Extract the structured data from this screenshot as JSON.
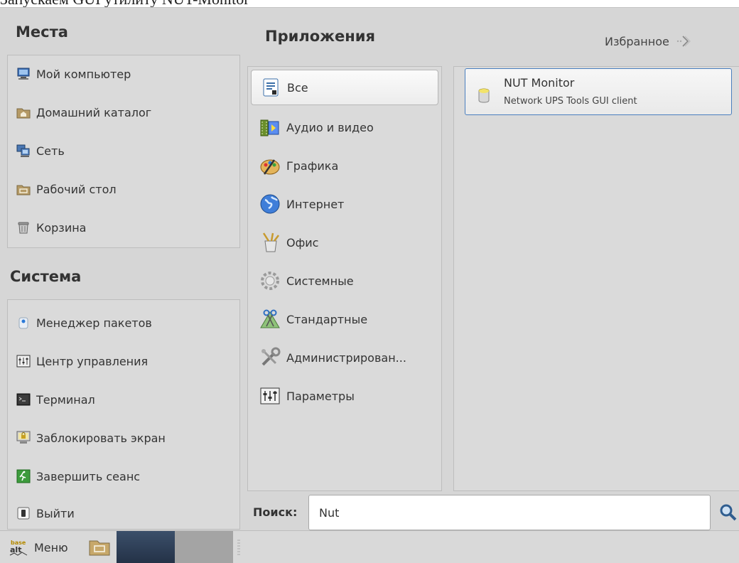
{
  "caption": "Запускаем GUI утилиту NUT-Monitor",
  "places": {
    "title": "Места",
    "items": [
      {
        "label": "Мой компьютер",
        "icon": "computer-icon"
      },
      {
        "label": "Домашний каталог",
        "icon": "home-folder-icon"
      },
      {
        "label": "Сеть",
        "icon": "network-icon"
      },
      {
        "label": "Рабочий стол",
        "icon": "desktop-folder-icon"
      },
      {
        "label": "Корзина",
        "icon": "trash-icon"
      }
    ]
  },
  "system": {
    "title": "Система",
    "items": [
      {
        "label": "Менеджер пакетов",
        "icon": "package-manager-icon"
      },
      {
        "label": "Центр управления",
        "icon": "control-center-icon"
      },
      {
        "label": "Терминал",
        "icon": "terminal-icon"
      },
      {
        "label": "Заблокировать экран",
        "icon": "lock-screen-icon"
      },
      {
        "label": "Завершить сеанс",
        "icon": "logout-icon"
      },
      {
        "label": "Выйти",
        "icon": "quit-icon"
      }
    ]
  },
  "apps": {
    "title": "Приложения",
    "favorites_label": "Избранное",
    "categories": [
      {
        "label": "Все",
        "icon": "all-apps-icon",
        "selected": true
      },
      {
        "label": "Аудио и видео",
        "icon": "multimedia-icon"
      },
      {
        "label": "Графика",
        "icon": "graphics-icon"
      },
      {
        "label": "Интернет",
        "icon": "internet-globe-icon"
      },
      {
        "label": "Офис",
        "icon": "office-icon"
      },
      {
        "label": "Системные",
        "icon": "system-gear-icon"
      },
      {
        "label": "Стандартные",
        "icon": "accessories-icon"
      },
      {
        "label": "Администрирован...",
        "icon": "administration-tools-icon"
      },
      {
        "label": "Параметры",
        "icon": "settings-panel-icon"
      }
    ],
    "results": [
      {
        "name": "NUT Monitor",
        "description": "Network UPS Tools GUI client",
        "icon": "ups-battery-icon"
      }
    ]
  },
  "search": {
    "label": "Поиск:",
    "value": "Nut"
  },
  "taskbar": {
    "menu_label": "Меню",
    "logo_text": "base alt"
  },
  "colors": {
    "accent_border": "#4a7fbf",
    "panel_bg": "#d6d6d6"
  }
}
